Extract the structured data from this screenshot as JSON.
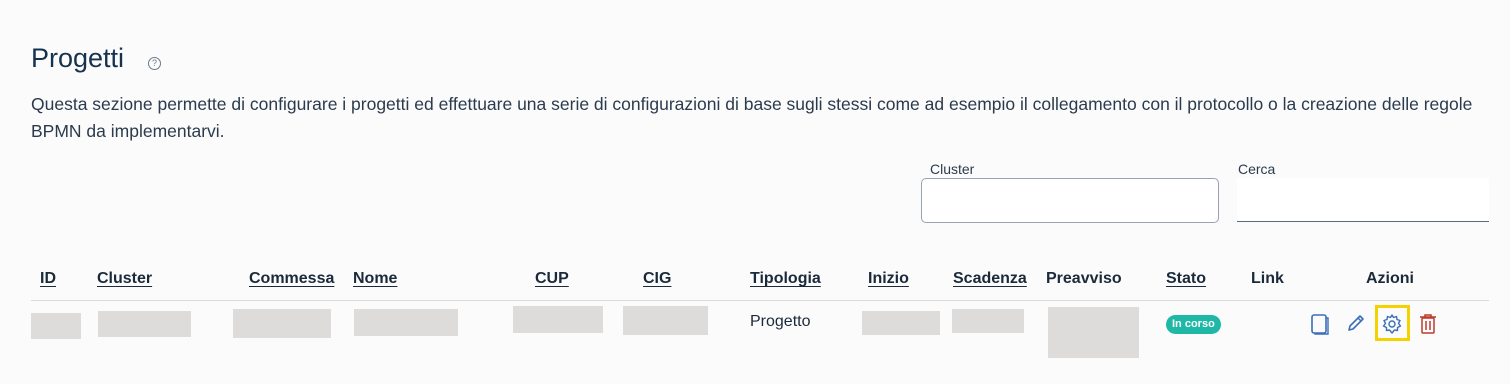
{
  "page": {
    "title": "Progetti",
    "help_glyph": "?",
    "description": "Questa sezione permette di configurare i progetti ed effettuare una serie di configurazioni di base sugli stessi come ad esempio il collegamento con il protocollo o la creazione delle regole BPMN da implementarvi."
  },
  "filters": {
    "cluster_label": "Cluster",
    "cluster_value": "",
    "search_label": "Cerca",
    "search_value": ""
  },
  "table": {
    "headers": {
      "id": "ID",
      "cluster": "Cluster",
      "commessa": "Commessa",
      "nome": "Nome",
      "cup": "CUP",
      "cig": "CIG",
      "tipologia": "Tipologia",
      "inizio": "Inizio",
      "scadenza": "Scadenza",
      "preavviso": "Preavviso",
      "stato": "Stato",
      "link": "Link",
      "azioni": "Azioni"
    },
    "rows": [
      {
        "tipologia": "Progetto",
        "stato": "In corso",
        "actions": [
          "copy-icon",
          "edit-icon",
          "settings-gear-icon",
          "trash-icon"
        ]
      }
    ]
  },
  "colors": {
    "badge": "#1fb8a7",
    "action_blue": "#3b6fb6",
    "delete_red": "#c0392b",
    "highlight": "#f3d200"
  }
}
